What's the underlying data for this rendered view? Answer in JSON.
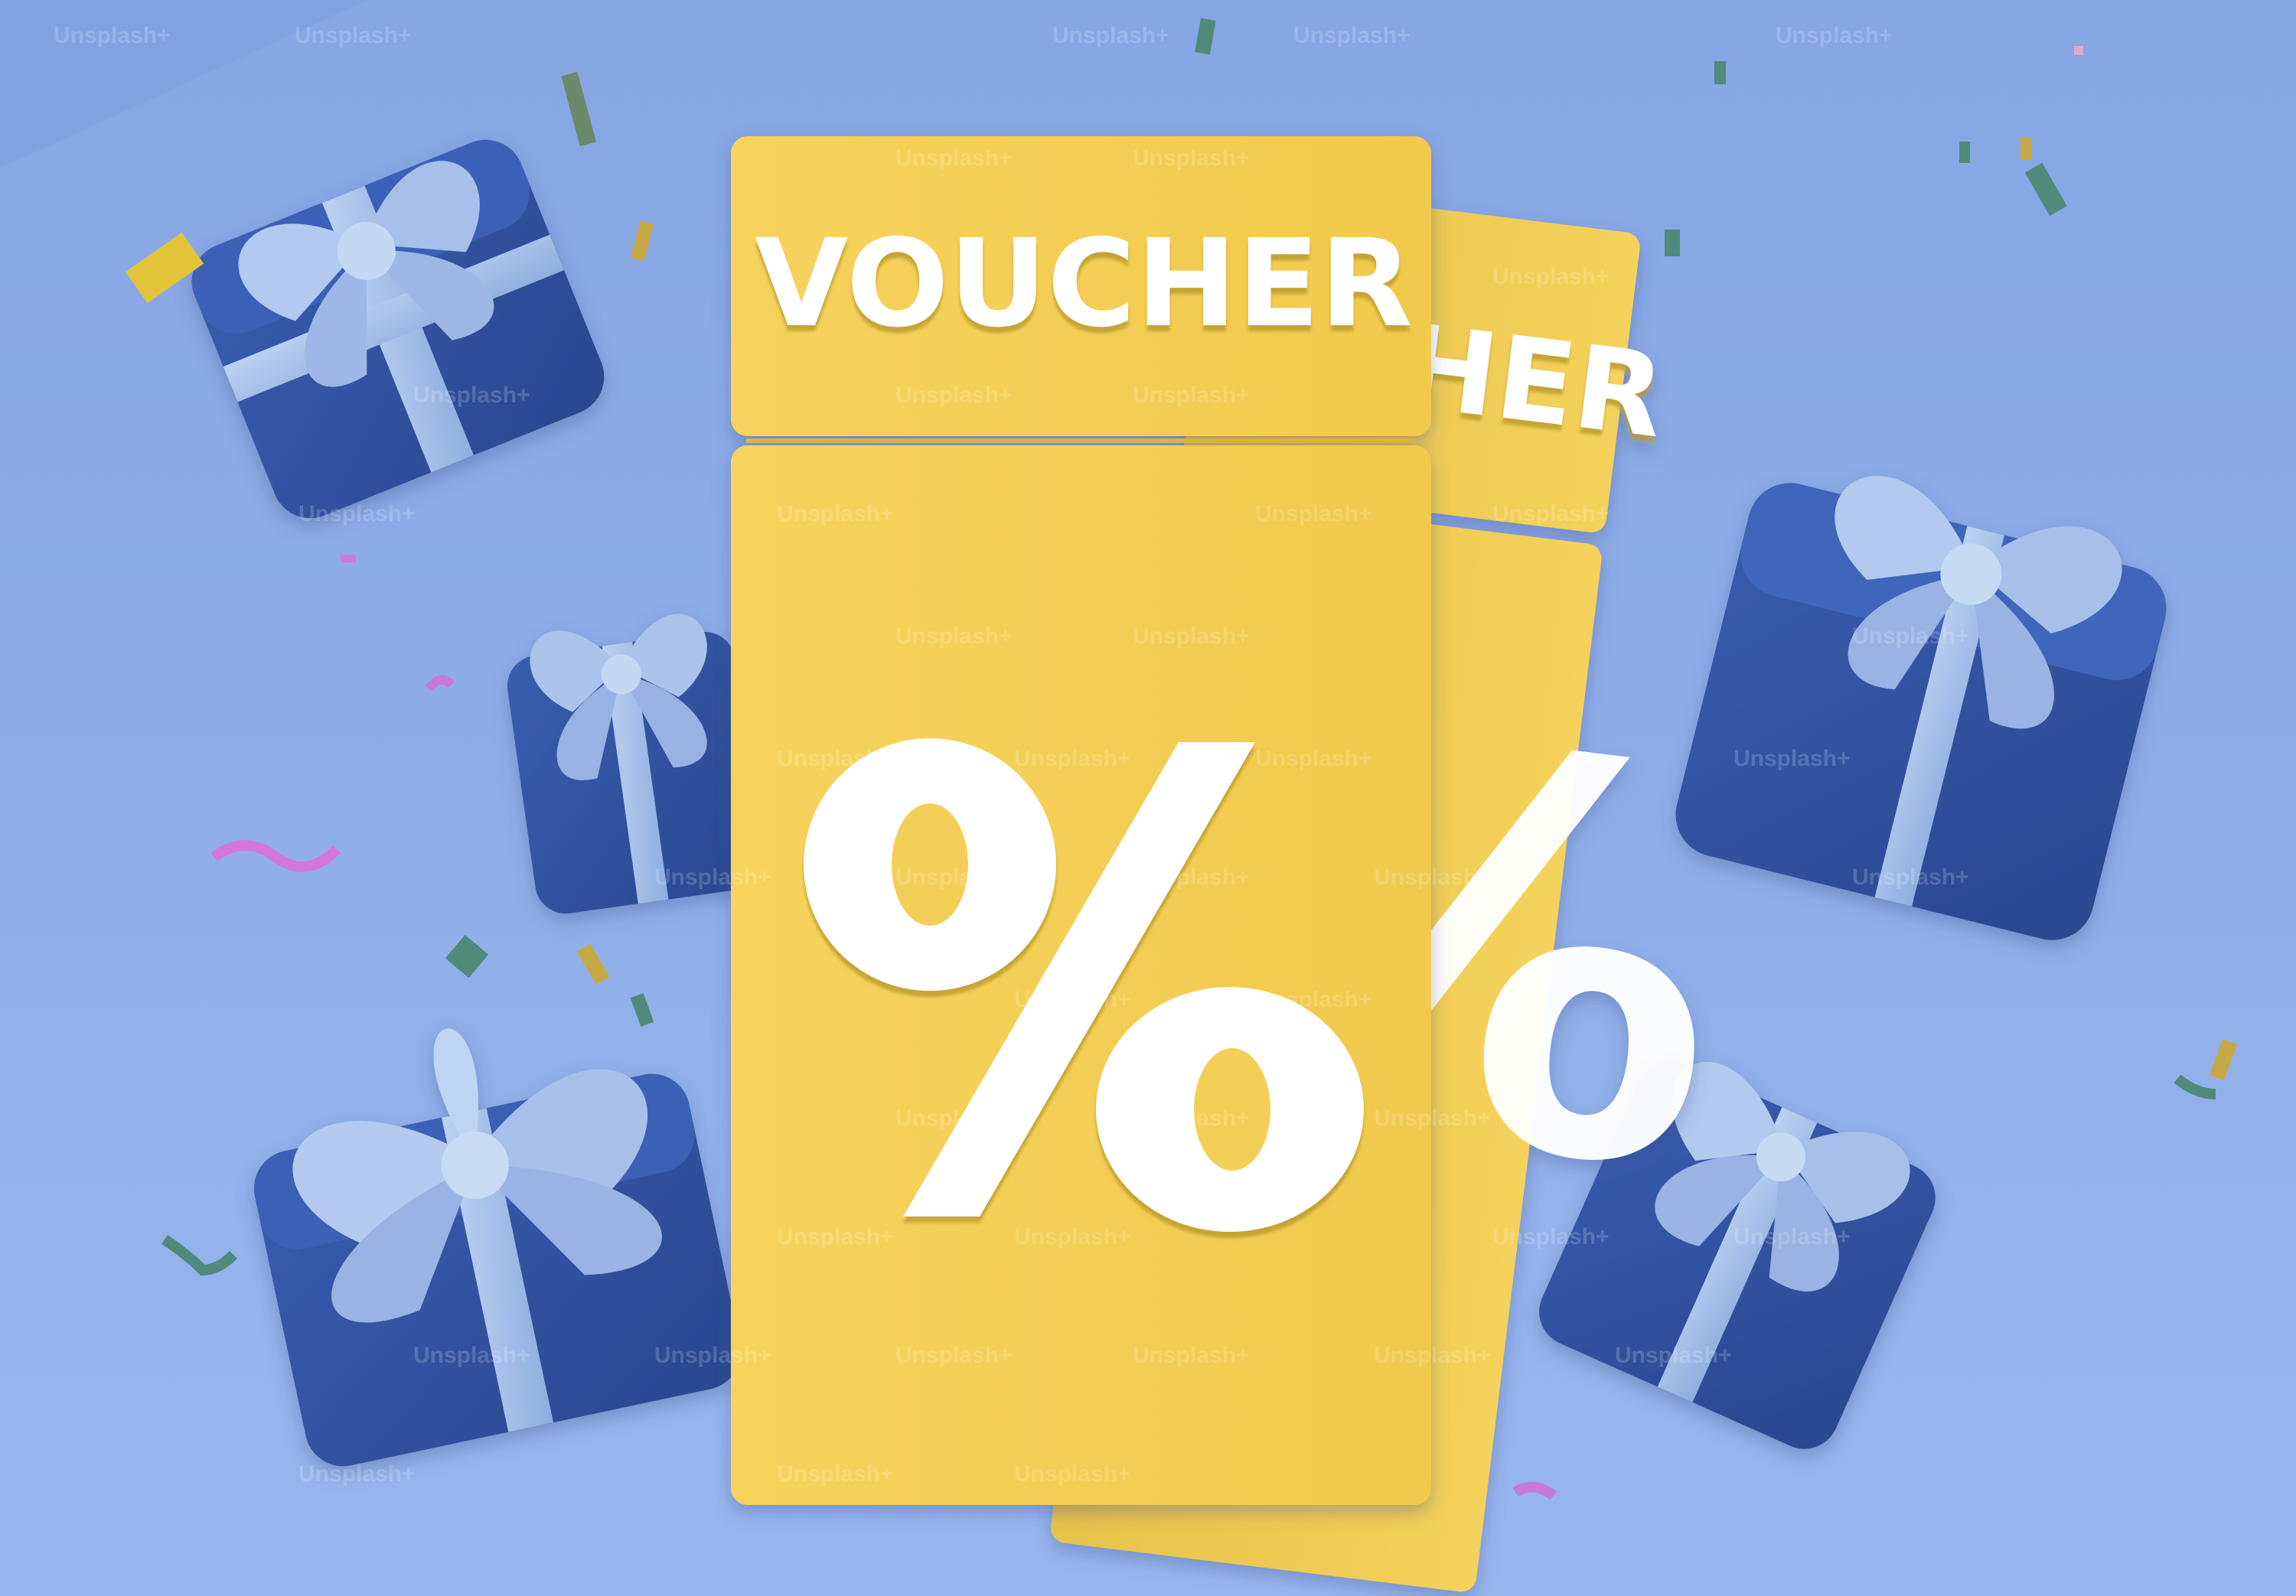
{
  "image": {
    "voucher_front_label": "VOUCHER",
    "voucher_back_label": "CHER",
    "percent_symbol": "%",
    "watermark": "Unsplash+"
  },
  "colors": {
    "background_top": "#87a7e6",
    "background_bottom": "#9bb8f0",
    "voucher_yellow": "#f6d15a",
    "voucher_shadow": "#e2bb3c",
    "gift_blue": "#2f4f9e",
    "ribbon_light": "#a9c3ea",
    "text_white": "#ffffff"
  }
}
